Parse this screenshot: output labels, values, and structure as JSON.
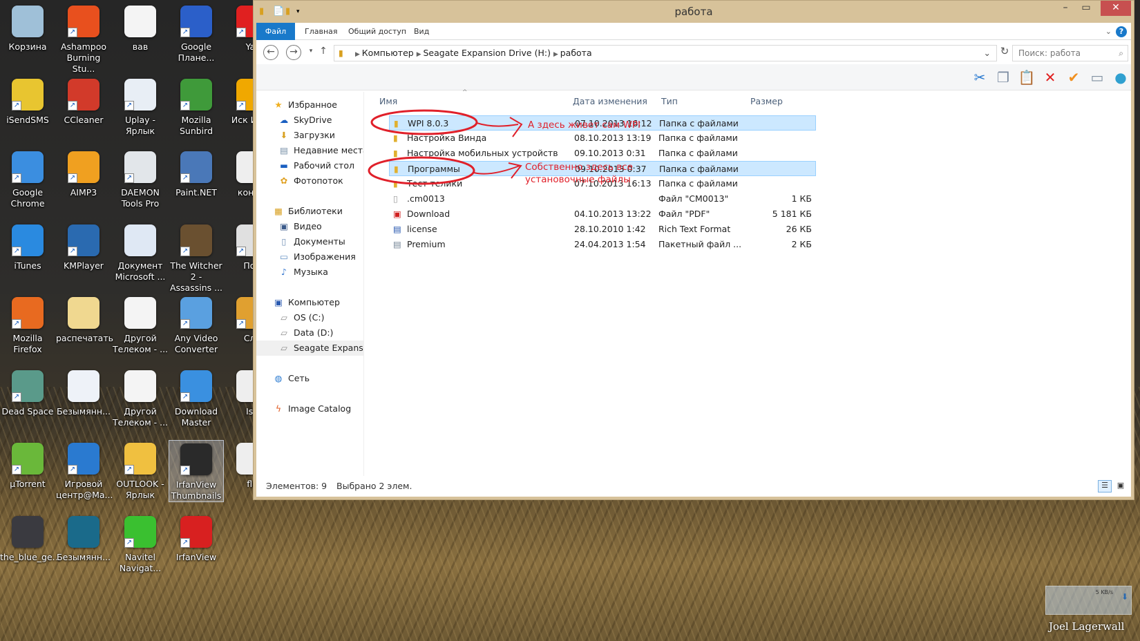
{
  "desktop": {
    "icons": [
      {
        "label": "Корзина",
        "icon": "recycle-bin-icon",
        "color": "#9fc0d8",
        "shortcut": false
      },
      {
        "label": "Ashampoo Burning Stu...",
        "icon": "ashampoo-icon",
        "color": "#e8501e",
        "shortcut": true
      },
      {
        "label": "вав",
        "icon": "text-file-icon",
        "color": "#f4f4f4",
        "shortcut": false
      },
      {
        "label": "Google Плане...",
        "icon": "google-earth-icon",
        "color": "#2b5fc9",
        "shortcut": true
      },
      {
        "label": "Yar",
        "icon": "yandex-icon",
        "color": "#e02020",
        "shortcut": true
      },
      {
        "label": "iSendSMS",
        "icon": "isendsms-icon",
        "color": "#e8c530",
        "shortcut": true
      },
      {
        "label": "CCleaner",
        "icon": "ccleaner-icon",
        "color": "#d23a2a",
        "shortcut": true
      },
      {
        "label": "Uplay - Ярлык",
        "icon": "uplay-icon",
        "color": "#e8eef5",
        "shortcut": true
      },
      {
        "label": "Mozilla Sunbird",
        "icon": "sunbird-icon",
        "color": "#3f9a3a",
        "shortcut": true
      },
      {
        "label": "Иск Инте",
        "icon": "search-app-icon",
        "color": "#f0a800",
        "shortcut": true
      },
      {
        "label": "Google Chrome",
        "icon": "chrome-icon",
        "color": "#3b8ee0",
        "shortcut": true
      },
      {
        "label": "AIMP3",
        "icon": "aimp-icon",
        "color": "#f0a020",
        "shortcut": true
      },
      {
        "label": "DAEMON Tools Pro",
        "icon": "daemon-tools-icon",
        "color": "#e2e6ea",
        "shortcut": true
      },
      {
        "label": "Paint.NET",
        "icon": "paintnet-icon",
        "color": "#4a78b8",
        "shortcut": true
      },
      {
        "label": "конфи",
        "icon": "document-icon",
        "color": "#eeeeee",
        "shortcut": false
      },
      {
        "label": "iTunes",
        "icon": "itunes-icon",
        "color": "#2a8ae0",
        "shortcut": true
      },
      {
        "label": "KMPlayer",
        "icon": "kmplayer-icon",
        "color": "#2a6ab0",
        "shortcut": true
      },
      {
        "label": "Документ Microsoft ...",
        "icon": "word-document-icon",
        "color": "#dfe8f4",
        "shortcut": false
      },
      {
        "label": "The Witcher 2 - Assassins ...",
        "icon": "witcher-icon",
        "color": "#6a5030",
        "shortcut": true
      },
      {
        "label": "Пои",
        "icon": "gamepad-icon",
        "color": "#e0e0e0",
        "shortcut": true
      },
      {
        "label": "Mozilla Firefox",
        "icon": "firefox-icon",
        "color": "#e86a20",
        "shortcut": true
      },
      {
        "label": "распечатать",
        "icon": "folder-icon",
        "color": "#f0d890",
        "shortcut": false
      },
      {
        "label": "Другой Телеком - ...",
        "icon": "powerpoint-file-icon",
        "color": "#f4f4f4",
        "shortcut": false
      },
      {
        "label": "Any Video Converter",
        "icon": "video-converter-icon",
        "color": "#5aa0e0",
        "shortcut": true
      },
      {
        "label": "Сло",
        "icon": "dictionary-icon",
        "color": "#e0a030",
        "shortcut": true
      },
      {
        "label": "Dead Space",
        "icon": "image-file-icon",
        "color": "#5a9a8a",
        "shortcut": true
      },
      {
        "label": "Безымянн...",
        "icon": "image-file-icon",
        "color": "#eef2f8",
        "shortcut": false
      },
      {
        "label": "Другой Телеком - ...",
        "icon": "powerpoint-file-icon",
        "color": "#f4f4f4",
        "shortcut": false
      },
      {
        "label": "Download Master",
        "icon": "download-master-icon",
        "color": "#3a90e0",
        "shortcut": true
      },
      {
        "label": "Ise",
        "icon": "document-icon",
        "color": "#eeeeee",
        "shortcut": false
      },
      {
        "label": "µTorrent",
        "icon": "utorrent-icon",
        "color": "#6ab83a",
        "shortcut": true
      },
      {
        "label": "Игровой центр@Ma...",
        "icon": "game-center-icon",
        "color": "#2a7ad0",
        "shortcut": true
      },
      {
        "label": "OUTLOOK - Ярлык",
        "icon": "outlook-icon",
        "color": "#f0c040",
        "shortcut": true
      },
      {
        "label": "IrfanView Thumbnails",
        "icon": "irfanview-thumbnails-icon",
        "color": "#2a2a2a",
        "shortcut": true,
        "selected": true
      },
      {
        "label": "fla",
        "icon": "document-icon",
        "color": "#eeeeee",
        "shortcut": false
      },
      {
        "label": "the_blue_ge...",
        "icon": "image-file-icon",
        "color": "#3a3a40",
        "shortcut": false
      },
      {
        "label": "Безымянн...",
        "icon": "image-file-icon",
        "color": "#1a6a8a",
        "shortcut": false
      },
      {
        "label": "Navitel Navigat...",
        "icon": "navitel-icon",
        "color": "#3ac030",
        "shortcut": true
      },
      {
        "label": "IrfanView",
        "icon": "irfanview-icon",
        "color": "#d82020",
        "shortcut": true
      }
    ]
  },
  "window": {
    "title": "работа",
    "ribbon_tabs": [
      "Файл",
      "Главная",
      "Общий доступ",
      "Вид"
    ],
    "breadcrumb": [
      "Компьютер",
      "Seagate Expansion Drive (H:)",
      "работа"
    ],
    "search_placeholder": "Поиск: работа",
    "nav": [
      {
        "label": "Избранное",
        "icon": "star-icon",
        "level": 0
      },
      {
        "label": "SkyDrive",
        "icon": "skydrive-icon",
        "level": 1
      },
      {
        "label": "Загрузки",
        "icon": "downloads-icon",
        "level": 1
      },
      {
        "label": "Недавние места",
        "icon": "recent-places-icon",
        "level": 1
      },
      {
        "label": "Рабочий стол",
        "icon": "desktop-icon",
        "level": 1
      },
      {
        "label": "Фотопоток",
        "icon": "photostream-icon",
        "level": 1
      },
      {
        "label": "Библиотеки",
        "icon": "libraries-icon",
        "level": 0
      },
      {
        "label": "Видео",
        "icon": "video-icon",
        "level": 1
      },
      {
        "label": "Документы",
        "icon": "documents-icon",
        "level": 1
      },
      {
        "label": "Изображения",
        "icon": "pictures-icon",
        "level": 1
      },
      {
        "label": "Музыка",
        "icon": "music-icon",
        "level": 1
      },
      {
        "label": "Компьютер",
        "icon": "computer-icon",
        "level": 0
      },
      {
        "label": "OS (C:)",
        "icon": "drive-icon",
        "level": 1
      },
      {
        "label": "Data (D:)",
        "icon": "drive-icon",
        "level": 1
      },
      {
        "label": "Seagate Expansion D",
        "icon": "drive-icon",
        "level": 1,
        "selected": true
      },
      {
        "label": "Сеть",
        "icon": "network-icon",
        "level": 0
      },
      {
        "label": "Image Catalog",
        "icon": "image-catalog-icon",
        "level": 0
      }
    ],
    "columns": [
      "Имя",
      "Дата изменения",
      "Тип",
      "Размер"
    ],
    "files": [
      {
        "name": "WPI 8.0.3",
        "date": "07.10.2013 16:12",
        "type": "Папка с файлами",
        "size": "",
        "icon": "folder-icon",
        "selected": true
      },
      {
        "name": "Настройка Винда",
        "date": "08.10.2013 13:19",
        "type": "Папка с файлами",
        "size": "",
        "icon": "folder-icon"
      },
      {
        "name": "Настройка мобильных устройств",
        "date": "09.10.2013 0:31",
        "type": "Папка с файлами",
        "size": "",
        "icon": "folder-icon"
      },
      {
        "name": "Программы",
        "date": "09.10.2013 0:37",
        "type": "Папка с файлами",
        "size": "",
        "icon": "folder-icon",
        "selected": true
      },
      {
        "name": "Тест телики",
        "date": "07.10.2013 16:13",
        "type": "Папка с файлами",
        "size": "",
        "icon": "folder-icon"
      },
      {
        "name": ".cm0013",
        "date": "",
        "type": "Файл \"CM0013\"",
        "size": "1 КБ",
        "icon": "file-icon"
      },
      {
        "name": "Download",
        "date": "04.10.2013 13:22",
        "type": "Файл \"PDF\"",
        "size": "5 181 КБ",
        "icon": "pdf-icon"
      },
      {
        "name": "license",
        "date": "28.10.2010 1:42",
        "type": "Rich Text Format",
        "size": "26 КБ",
        "icon": "rtf-icon"
      },
      {
        "name": "Premium",
        "date": "24.04.2013 1:54",
        "type": "Пакетный файл ...",
        "size": "2 КБ",
        "icon": "batch-file-icon"
      }
    ],
    "status": {
      "items": "Элементов: 9",
      "selected": "Выбрано 2 элем."
    }
  },
  "annotations": {
    "note1": "А здесь живет сам WPI",
    "note2_line1": "Собственно здесь все",
    "note2_line2": "установочные файлы",
    "color": "#e0202a"
  },
  "tray": {
    "speed": "5 KB/s"
  },
  "wallpaper_credit": "Joel Lagerwall"
}
